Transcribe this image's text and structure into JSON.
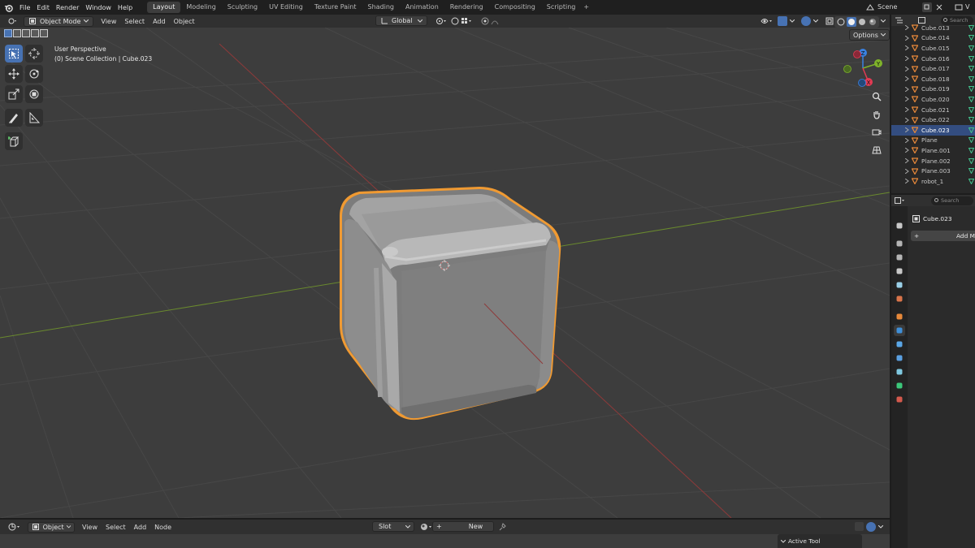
{
  "menus": [
    "File",
    "Edit",
    "Render",
    "Window",
    "Help"
  ],
  "workspaces": [
    "Layout",
    "Modeling",
    "Sculpting",
    "UV Editing",
    "Texture Paint",
    "Shading",
    "Animation",
    "Rendering",
    "Compositing",
    "Scripting"
  ],
  "active_workspace": "Layout",
  "add_workspace_symbol": "+",
  "scene_name": "Scene",
  "viewlayer_initial": "V",
  "viewport_header": {
    "mode": "Object Mode",
    "menus": [
      "View",
      "Select",
      "Add",
      "Object"
    ],
    "orientation": "Global",
    "options_label": "Options"
  },
  "viewport": {
    "perspective_label": "User Perspective",
    "collection_label": "(0) Scene Collection | Cube.023",
    "gizmo_axes": {
      "x": "X",
      "y": "Y",
      "z": "Z"
    }
  },
  "outliner": {
    "search_placeholder": "Search",
    "items": [
      {
        "label": "Cube.013",
        "type": "mesh",
        "selected": false
      },
      {
        "label": "Cube.014",
        "type": "mesh",
        "selected": false
      },
      {
        "label": "Cube.015",
        "type": "mesh",
        "selected": false
      },
      {
        "label": "Cube.016",
        "type": "mesh",
        "selected": false
      },
      {
        "label": "Cube.017",
        "type": "mesh",
        "selected": false
      },
      {
        "label": "Cube.018",
        "type": "mesh",
        "selected": false
      },
      {
        "label": "Cube.019",
        "type": "mesh",
        "selected": false
      },
      {
        "label": "Cube.020",
        "type": "mesh",
        "selected": false
      },
      {
        "label": "Cube.021",
        "type": "mesh",
        "selected": false
      },
      {
        "label": "Cube.022",
        "type": "mesh",
        "selected": false
      },
      {
        "label": "Cube.023",
        "type": "mesh",
        "selected": true
      },
      {
        "label": "Plane",
        "type": "mesh",
        "selected": false
      },
      {
        "label": "Plane.001",
        "type": "mesh",
        "selected": false
      },
      {
        "label": "Plane.002",
        "type": "mesh",
        "selected": false
      },
      {
        "label": "Plane.003",
        "type": "mesh",
        "selected": false
      },
      {
        "label": "robot_1",
        "type": "mesh",
        "selected": false
      }
    ]
  },
  "properties": {
    "search_placeholder": "Search",
    "object_name": "Cube.023",
    "add_modifier_label": "Add M",
    "add_symbol": "+",
    "tab_colors": [
      "#c8c8c8",
      "#b5b5b5",
      "#b5b5b5",
      "#c8c8c8",
      "#9ad0e8",
      "#d9744a",
      "#e8893a",
      "#3f8fd8",
      "#5aa6e6",
      "#5a9fe0",
      "#7fc8e0",
      "#3cc77a",
      "#d4594d"
    ]
  },
  "bottom_bar": {
    "mode": "Object",
    "menus": [
      "View",
      "Select",
      "Add",
      "Node"
    ],
    "slot_label": "Slot",
    "new_label": "New",
    "new_plus": "+",
    "active_tool_label": "Active Tool"
  },
  "colors": {
    "accent_blue": "#4772b3",
    "selection_orange": "#f09a32",
    "axis_red": "#e33a53",
    "axis_green": "#7fb32a",
    "axis_blue": "#3a82e2"
  }
}
